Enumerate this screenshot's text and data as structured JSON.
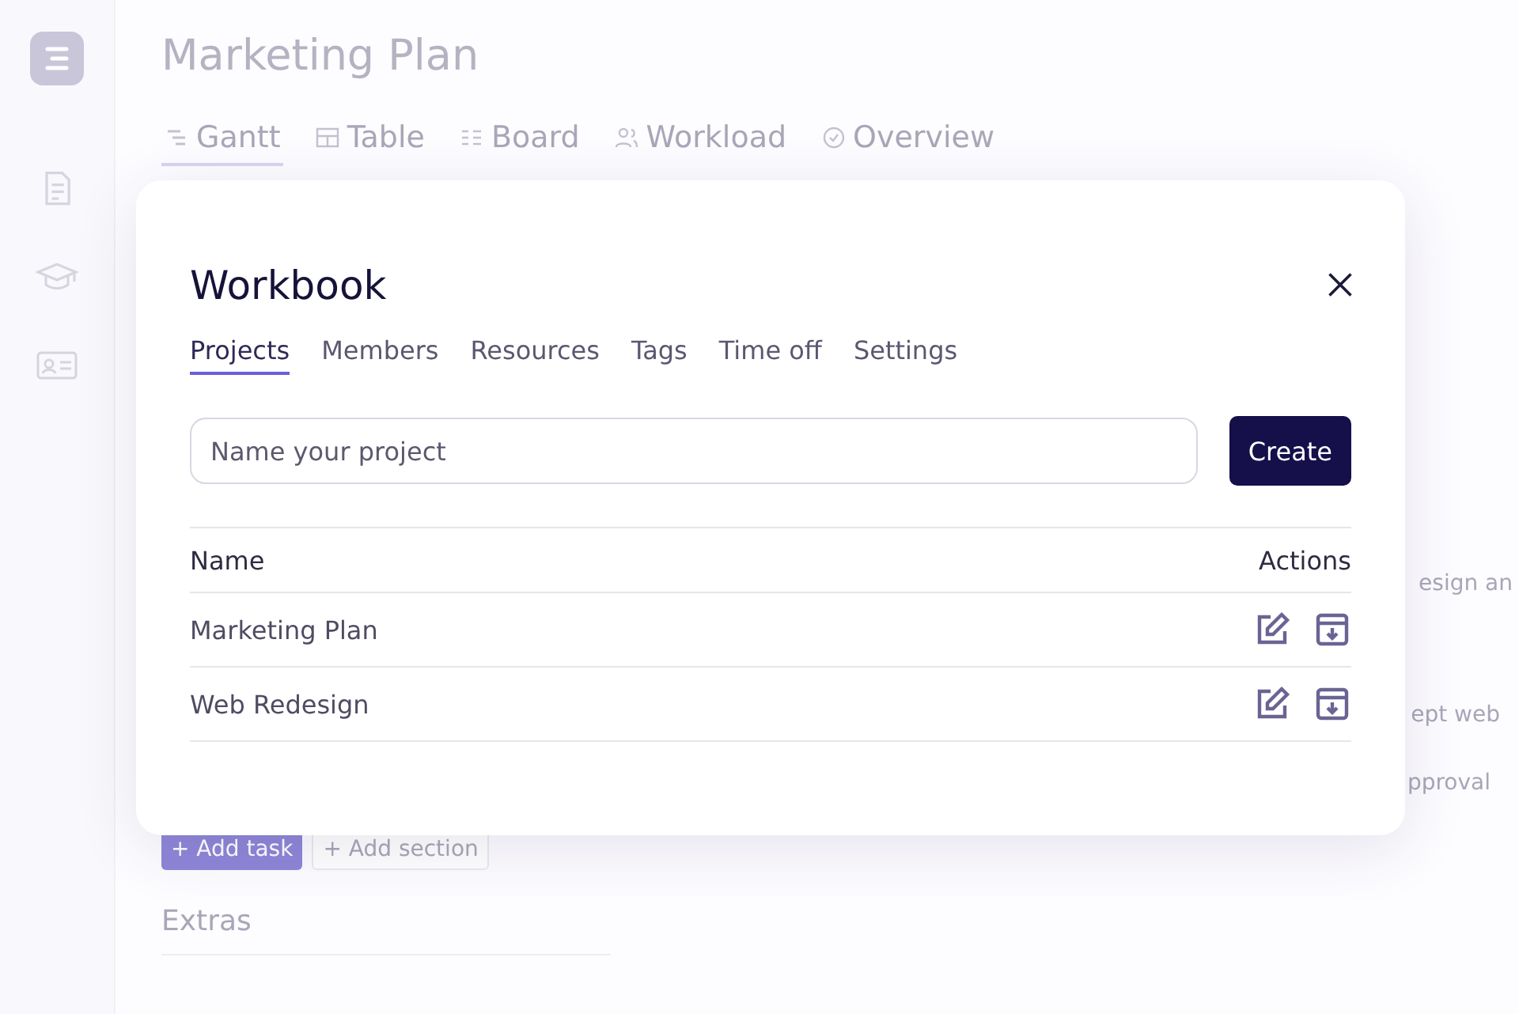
{
  "page": {
    "title": "Marketing Plan",
    "tabs": [
      {
        "label": "Gantt",
        "selected": true
      },
      {
        "label": "Table",
        "selected": false
      },
      {
        "label": "Board",
        "selected": false
      },
      {
        "label": "Workload",
        "selected": false
      },
      {
        "label": "Overview",
        "selected": false
      }
    ],
    "task_fragments": [
      "esign an",
      "ept web",
      "pproval"
    ],
    "add_task": "+ Add task",
    "add_section": "+ Add section",
    "section_title": "Extras"
  },
  "dialog": {
    "title": "Workbook",
    "tabs": [
      {
        "label": "Projects",
        "selected": true
      },
      {
        "label": "Members",
        "selected": false
      },
      {
        "label": "Resources",
        "selected": false
      },
      {
        "label": "Tags",
        "selected": false
      },
      {
        "label": "Time off",
        "selected": false
      },
      {
        "label": "Settings",
        "selected": false
      }
    ],
    "input": {
      "placeholder": "Name your project"
    },
    "create_button": "Create",
    "table": {
      "columns": [
        "Name",
        "Actions"
      ],
      "rows": [
        {
          "name": "Marketing Plan"
        },
        {
          "name": "Web Redesign"
        }
      ]
    }
  }
}
